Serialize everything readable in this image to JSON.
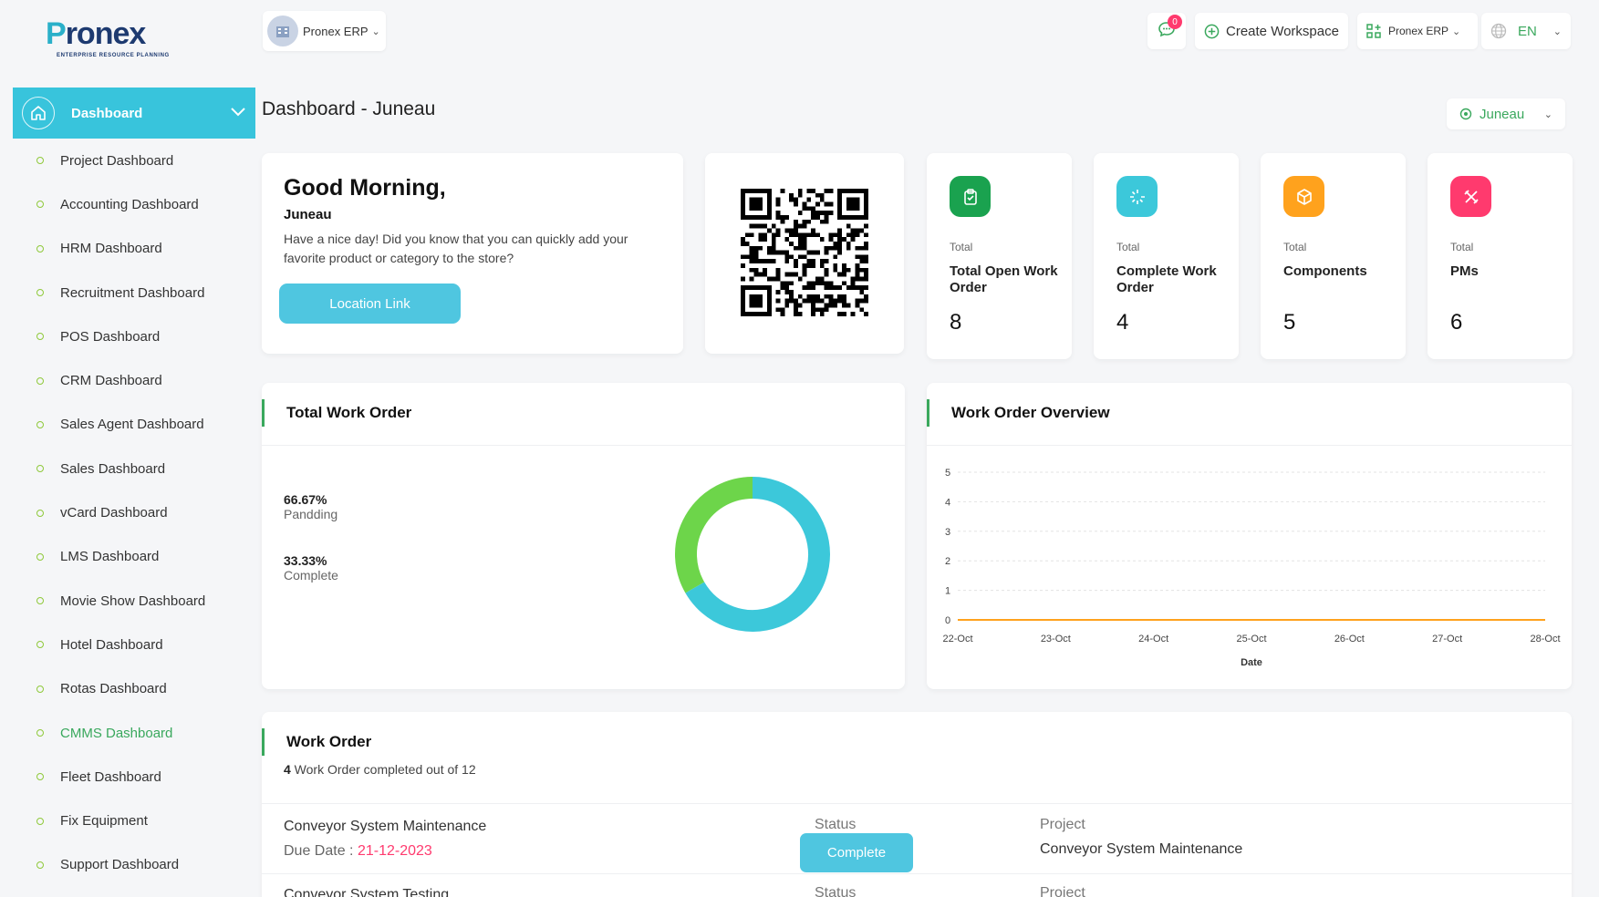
{
  "brand": {
    "logo_text_a": "P",
    "logo_text_b": "ronex",
    "logo_sub": "ENTERPRISE RESOURCE PLANNING"
  },
  "sidebar": {
    "active_label": "Dashboard",
    "items": [
      {
        "label": "Project Dashboard"
      },
      {
        "label": "Accounting Dashboard"
      },
      {
        "label": "HRM Dashboard"
      },
      {
        "label": "Recruitment Dashboard"
      },
      {
        "label": "POS Dashboard"
      },
      {
        "label": "CRM Dashboard"
      },
      {
        "label": "Sales Agent Dashboard"
      },
      {
        "label": "Sales Dashboard"
      },
      {
        "label": "vCard Dashboard"
      },
      {
        "label": "LMS Dashboard"
      },
      {
        "label": "Movie Show Dashboard"
      },
      {
        "label": "Hotel Dashboard"
      },
      {
        "label": "Rotas Dashboard"
      },
      {
        "label": "CMMS Dashboard"
      },
      {
        "label": "Fleet Dashboard"
      },
      {
        "label": "Fix Equipment"
      },
      {
        "label": "Support Dashboard"
      }
    ],
    "active_index": 13
  },
  "topbar": {
    "workspace_label": "Pronex ERP",
    "notification_count": "0",
    "create_workspace": "Create Workspace",
    "erp_menu": "Pronex ERP",
    "language": "EN"
  },
  "page": {
    "title": "Dashboard - Juneau",
    "location_select": "Juneau"
  },
  "greeting": {
    "title": "Good Morning,",
    "name": "Juneau",
    "message": "Have a nice day! Did you know that you can quickly add your favorite product or category to the store?",
    "button": "Location Link"
  },
  "stats": [
    {
      "small": "Total",
      "label": "Total Open Work Order",
      "value": "8",
      "color": "#1aa24f",
      "icon": "clipboard-check-icon"
    },
    {
      "small": "Total",
      "label": "Complete Work Order",
      "value": "4",
      "color": "#3cc8da",
      "icon": "sparkle-cursor-icon"
    },
    {
      "small": "Total",
      "label": "Components",
      "value": "5",
      "color": "#ffa21d",
      "icon": "box-icon"
    },
    {
      "small": "Total",
      "label": "PMs",
      "value": "6",
      "color": "#ff3a6e",
      "icon": "tools-icon"
    }
  ],
  "total_work_order": {
    "title": "Total Work Order",
    "legend": [
      {
        "pct": "66.67%",
        "name": "Pandding"
      },
      {
        "pct": "33.33%",
        "name": "Complete"
      }
    ]
  },
  "overview": {
    "title": "Work Order Overview"
  },
  "chart_data": [
    {
      "type": "pie",
      "labels": [
        "Pandding",
        "Complete"
      ],
      "values": [
        66.67,
        33.33
      ],
      "colors": [
        "#3cc8da",
        "#6dd54a"
      ]
    },
    {
      "type": "line",
      "xlabel": "Date",
      "categories": [
        "22-Oct",
        "23-Oct",
        "24-Oct",
        "25-Oct",
        "26-Oct",
        "27-Oct",
        "28-Oct"
      ],
      "yticks": [
        "0",
        "1",
        "2",
        "3",
        "4",
        "5"
      ],
      "ylim": [
        0,
        5
      ],
      "grid": true,
      "series": [
        {
          "values": [
            0,
            0,
            0,
            0,
            0,
            0,
            0
          ],
          "color": "#ffa21d"
        }
      ]
    }
  ],
  "work_order": {
    "title": "Work Order",
    "completed_count": "4",
    "completed_text": " Work Order completed out of 12",
    "rows": [
      {
        "name": "Conveyor System Maintenance",
        "due_label": "Due Date : ",
        "due_date": "21-12-2023",
        "status_label": "Status",
        "status": "Complete",
        "project_label": "Project",
        "project": "Conveyor System Maintenance"
      },
      {
        "name": "Conveyor System Testing",
        "status_label": "Status",
        "project_label": "Project"
      }
    ]
  }
}
